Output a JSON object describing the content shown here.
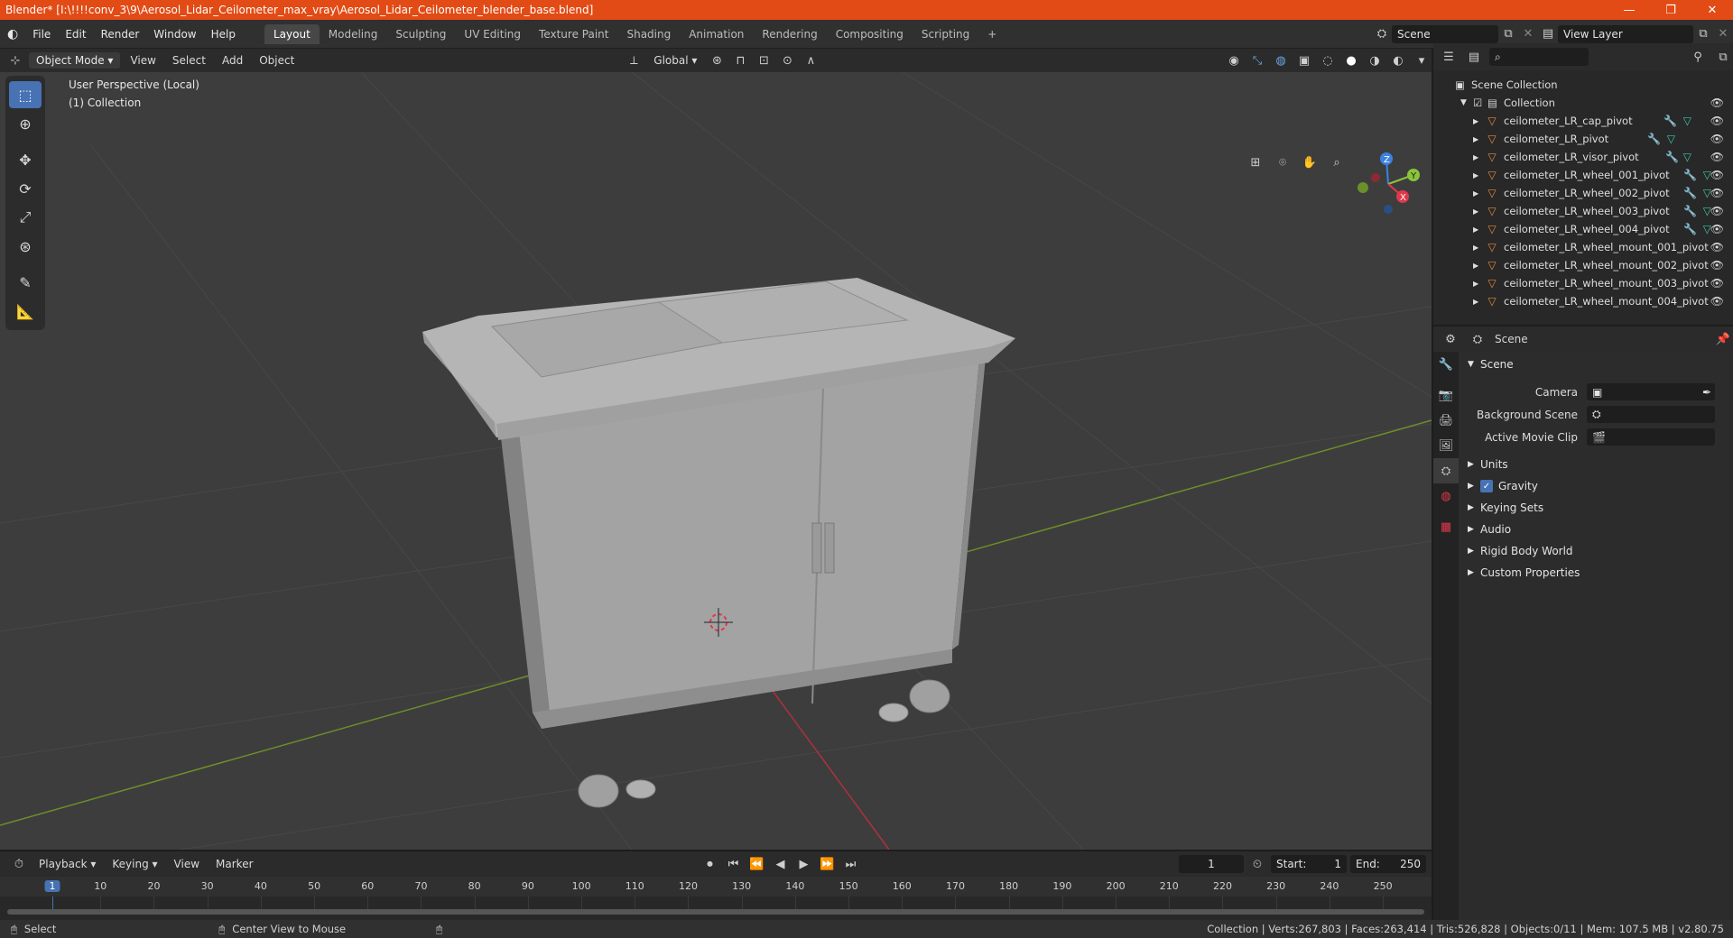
{
  "window": {
    "title": "Blender* [I:\\!!!!conv_3\\9\\Aerosol_Lidar_Ceilometer_max_vray\\Aerosol_Lidar_Ceilometer_blender_base.blend]",
    "minimize": "—",
    "maximize": "❐",
    "close": "✕"
  },
  "menu": {
    "logo": "◐",
    "items": [
      "File",
      "Edit",
      "Render",
      "Window",
      "Help"
    ],
    "workspaces": [
      "Layout",
      "Modeling",
      "Sculpting",
      "UV Editing",
      "Texture Paint",
      "Shading",
      "Animation",
      "Rendering",
      "Compositing",
      "Scripting"
    ],
    "active_workspace": "Layout",
    "add_workspace": "+",
    "scene_label": "Scene",
    "view_layer_label": "View Layer"
  },
  "viewport_header": {
    "mode": "Object Mode",
    "menus": [
      "View",
      "Select",
      "Add",
      "Object"
    ],
    "transform_orientation": "Global"
  },
  "viewport": {
    "perspective_label": "User Perspective (Local)",
    "collection_label": "(1) Collection",
    "gizmo_axes": [
      "Z",
      "Y",
      "X"
    ]
  },
  "outliner": {
    "root": "Scene Collection",
    "collection": "Collection",
    "objects": [
      {
        "name": "ceilometer_LR_cap_pivot",
        "modifier": true,
        "mesh": true
      },
      {
        "name": "ceilometer_LR_pivot",
        "modifier": true,
        "mesh": true
      },
      {
        "name": "ceilometer_LR_visor_pivot",
        "modifier": true,
        "mesh": true
      },
      {
        "name": "ceilometer_LR_wheel_001_pivot",
        "modifier": true,
        "mesh": true
      },
      {
        "name": "ceilometer_LR_wheel_002_pivot",
        "modifier": true,
        "mesh": true
      },
      {
        "name": "ceilometer_LR_wheel_003_pivot",
        "modifier": true,
        "mesh": true
      },
      {
        "name": "ceilometer_LR_wheel_004_pivot",
        "modifier": true,
        "mesh": true
      },
      {
        "name": "ceilometer_LR_wheel_mount_001_pivot",
        "modifier": false,
        "mesh": false
      },
      {
        "name": "ceilometer_LR_wheel_mount_002_pivot",
        "modifier": false,
        "mesh": false
      },
      {
        "name": "ceilometer_LR_wheel_mount_003_pivot",
        "modifier": false,
        "mesh": false
      },
      {
        "name": "ceilometer_LR_wheel_mount_004_pivot",
        "modifier": false,
        "mesh": false
      }
    ]
  },
  "properties": {
    "header_title": "Scene",
    "section_title": "Scene",
    "fields": [
      {
        "label": "Camera",
        "value": ""
      },
      {
        "label": "Background Scene",
        "value": ""
      },
      {
        "label": "Active Movie Clip",
        "value": ""
      }
    ],
    "panels": [
      {
        "label": "Units",
        "checkbox": false
      },
      {
        "label": "Gravity",
        "checkbox": true
      },
      {
        "label": "Keying Sets",
        "checkbox": false
      },
      {
        "label": "Audio",
        "checkbox": false
      },
      {
        "label": "Rigid Body World",
        "checkbox": false
      },
      {
        "label": "Custom Properties",
        "checkbox": false
      }
    ]
  },
  "timeline": {
    "menus": [
      "Playback",
      "Keying",
      "View",
      "Marker"
    ],
    "current_frame": "1",
    "start_label": "Start:",
    "start": "1",
    "end_label": "End:",
    "end": "250",
    "ticks": [
      "1",
      "10",
      "20",
      "30",
      "40",
      "50",
      "60",
      "70",
      "80",
      "90",
      "100",
      "110",
      "120",
      "130",
      "140",
      "150",
      "160",
      "170",
      "180",
      "190",
      "200",
      "210",
      "220",
      "230",
      "240",
      "250"
    ]
  },
  "statusbar": {
    "left_action": "Select",
    "middle_action": "Center View to Mouse",
    "stats": "Collection | Verts:267,803 | Faces:263,414 | Tris:526,828 | Objects:0/11 | Mem: 107.5 MB | v2.80.75"
  },
  "colors": {
    "title_bar": "#e24b15",
    "accent": "#4772b3",
    "object_icon": "#e38a3b",
    "x_axis": "#e0384b",
    "y_axis": "#8ac43b",
    "z_axis": "#3c82e0"
  }
}
